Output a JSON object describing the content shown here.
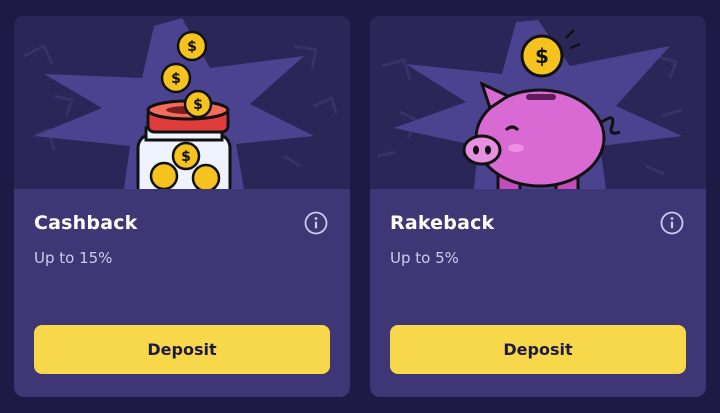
{
  "cards": [
    {
      "title": "Cashback",
      "subtitle": "Up to 15%",
      "button_label": "Deposit",
      "illustration": "coin-jar-icon",
      "coin_symbol": "$"
    },
    {
      "title": "Rakeback",
      "subtitle": "Up to 5%",
      "button_label": "Deposit",
      "illustration": "piggy-bank-icon",
      "coin_symbol": "$"
    }
  ],
  "colors": {
    "page_background": "#1d1b45",
    "card_background": "#3e3675",
    "hero_background": "#2a2658",
    "burst": "#4b4390",
    "button": "#f8d84b",
    "button_text": "#1f1b40",
    "coin": "#f6c21d",
    "piggy": "#d96ad3"
  }
}
